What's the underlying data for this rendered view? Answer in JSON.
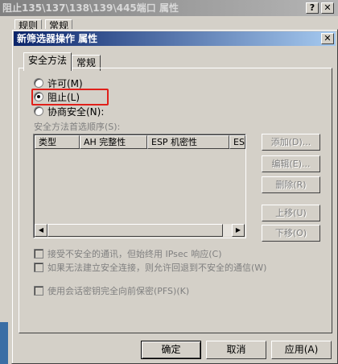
{
  "back_window": {
    "title": "阻止135\\137\\138\\139\\445端口  属性",
    "help_btn": "?",
    "close_btn": "✕",
    "tabs": [
      "规则",
      "常规"
    ]
  },
  "dialog": {
    "title": "新筛选器操作 属性",
    "close_btn": "✕",
    "tabs": [
      "安全方法",
      "常规"
    ],
    "active_tab": 0,
    "radios": [
      {
        "label": "许可(M)",
        "checked": false
      },
      {
        "label": "阻止(L)",
        "checked": true
      },
      {
        "label": "协商安全(N):",
        "checked": false
      }
    ],
    "highlight_color": "#e0201a",
    "security_label": "安全方法首选顺序(S):",
    "list_columns": [
      "类型",
      "AH 完整性",
      "ESP 机密性",
      "ESI"
    ],
    "side_buttons": [
      "添加(D)...",
      "编辑(E)...",
      "删除(R)",
      "上移(U)",
      "下移(O)"
    ],
    "checkboxes": [
      {
        "label": "接受不安全的通讯，但始终用 IPsec 响应(C)",
        "checked": false
      },
      {
        "label": "如果无法建立安全连接，则允许回退到不安全的通信(W)",
        "checked": false
      },
      {
        "label": "使用会话密钥完全向前保密(PFS)(K)",
        "checked": false
      }
    ],
    "bottom_buttons": [
      "确定",
      "取消",
      "应用(A)"
    ],
    "scroll_left": "◀",
    "scroll_right": "▶"
  }
}
